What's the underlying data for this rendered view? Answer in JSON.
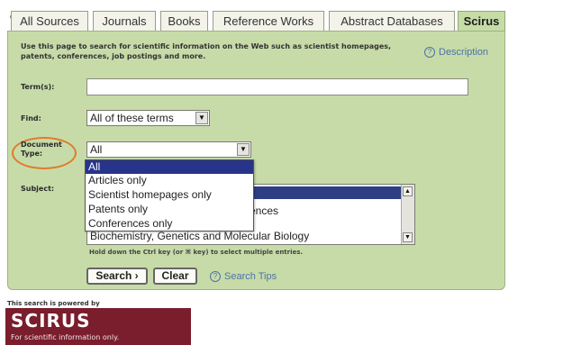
{
  "tabs": [
    "All Sources",
    "Journals",
    "Books",
    "Reference Works",
    "Abstract Databases",
    "Scirus"
  ],
  "active_tab": "Scirus",
  "colors": {
    "panel_bg": "#c7dba8",
    "accent_link": "#4d72a8",
    "highlight_oval": "#e07a2a",
    "selection": "#26348a",
    "logo_bg": "#7a1d2c"
  },
  "intro": {
    "text": "Use this page to search for scientific information on the Web such as scientist homepages, patents, conferences, job postings and more.",
    "description_link": "Description",
    "description_icon": "help-circle-icon"
  },
  "form": {
    "terms_label": "Term(s):",
    "terms_value": "",
    "find_label": "Find:",
    "find_value": "All of these terms",
    "doctype_label_line1": "Document",
    "doctype_label_line2": "Type:",
    "doctype_value": "All",
    "doctype_options": [
      "All",
      "Articles only",
      "Scientist homepages only",
      "Patents only",
      "Conferences only"
    ],
    "doctype_selected": "All",
    "subject_label": "Subject:",
    "subject_visible": [
      "",
      "ences",
      "Biochemistry, Genetics and Molecular Biology"
    ],
    "hint": "Hold down the Ctrl key (or ⌘ key) to select multiple entries.",
    "search_button": "Search ›",
    "clear_button": "Clear",
    "search_tips": "Search Tips"
  },
  "footer": {
    "powered_by": "This search is powered by",
    "logo": "SCIRUS",
    "tagline": "For scientific information only."
  }
}
